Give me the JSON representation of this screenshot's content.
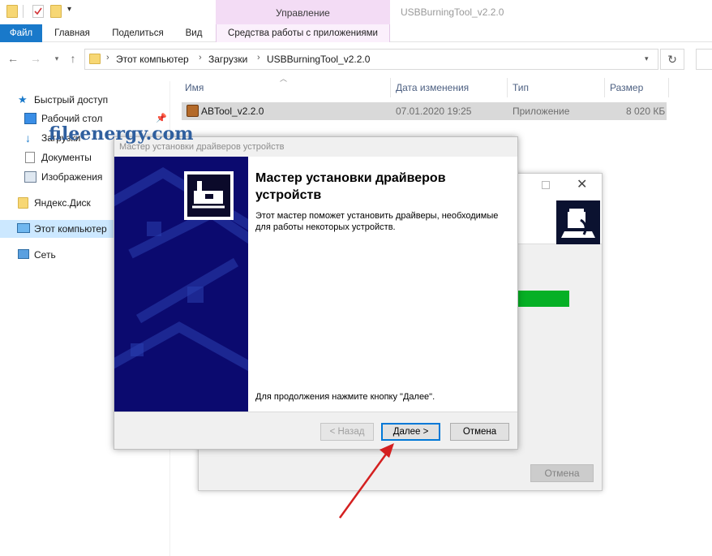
{
  "ribbon": {
    "context_header": "Управление",
    "window_title": "USBBurningTool_v2.2.0",
    "tabs": {
      "file": "Файл",
      "home": "Главная",
      "share": "Поделиться",
      "view": "Вид",
      "app_tools": "Средства работы с приложениями"
    }
  },
  "address": {
    "crumbs": [
      "Этот компьютер",
      "Загрузки",
      "USBBurningTool_v2.2.0"
    ]
  },
  "navpane": {
    "items": [
      {
        "label": "Быстрый доступ",
        "icon": "star-icon"
      },
      {
        "label": "Рабочий стол",
        "icon": "desktop-icon"
      },
      {
        "label": "Загрузки",
        "icon": "download-icon"
      },
      {
        "label": "Документы",
        "icon": "documents-icon"
      },
      {
        "label": "Изображения",
        "icon": "pictures-icon"
      },
      {
        "label": "Яндекс.Диск",
        "icon": "folder-icon"
      },
      {
        "label": "Этот компьютер",
        "icon": "computer-icon"
      },
      {
        "label": "Сеть",
        "icon": "network-icon"
      }
    ]
  },
  "filelist": {
    "columns": [
      "Имя",
      "Дата изменения",
      "Тип",
      "Размер"
    ],
    "rows": [
      {
        "name": "ABTool_v2.2.0",
        "modified": "07.01.2020 19:25",
        "type": "Приложение",
        "size": "8 020 КБ"
      }
    ]
  },
  "watermark": "fileenergy.com",
  "installer_bg": {
    "cancel_label": "Отмена"
  },
  "wizard": {
    "title": "Мастер установки драйверов устройств",
    "heading": "Мастер установки драйверов устройств",
    "description": "Этот мастер поможет установить драйверы, необходимые для работы некоторых устройств.",
    "footer_hint": "Для продолжения нажмите кнопку \"Далее\".",
    "back_label": "< Назад",
    "next_label": "Далее >",
    "cancel_label": "Отмена"
  },
  "colors": {
    "file_tab": "#1979ca",
    "context_tab": "#f3dcf5",
    "wizard_banner": "#0b0a6f",
    "progress": "#06b025",
    "annotation_arrow": "#d42020",
    "watermark": "#2f5f9e"
  }
}
